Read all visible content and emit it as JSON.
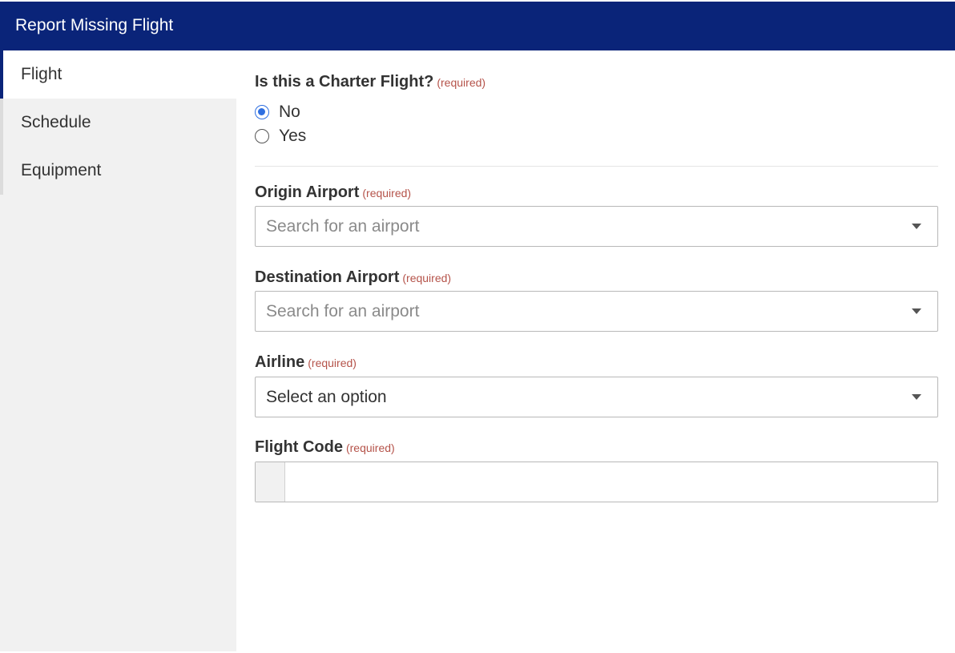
{
  "header": {
    "title": "Report Missing Flight",
    "color": "#0a2479"
  },
  "sidebar": {
    "items": [
      {
        "label": "Flight",
        "active": true
      },
      {
        "label": "Schedule",
        "active": false
      },
      {
        "label": "Equipment",
        "active": false
      }
    ]
  },
  "form": {
    "charter": {
      "label": "Is this a Charter Flight?",
      "required": "(required)",
      "options": [
        {
          "label": "No",
          "checked": true
        },
        {
          "label": "Yes",
          "checked": false
        }
      ]
    },
    "origin": {
      "label": "Origin Airport",
      "required": "(required)",
      "placeholder": "Search for an airport",
      "icon": "chevron-down-icon"
    },
    "destination": {
      "label": "Destination Airport",
      "required": "(required)",
      "placeholder": "Search for an airport",
      "icon": "chevron-down-icon"
    },
    "airline": {
      "label": "Airline",
      "required": "(required)",
      "value": "Select an option",
      "icon": "chevron-down-icon"
    },
    "flight_code": {
      "label": "Flight Code",
      "required": "(required)",
      "value": ""
    }
  }
}
